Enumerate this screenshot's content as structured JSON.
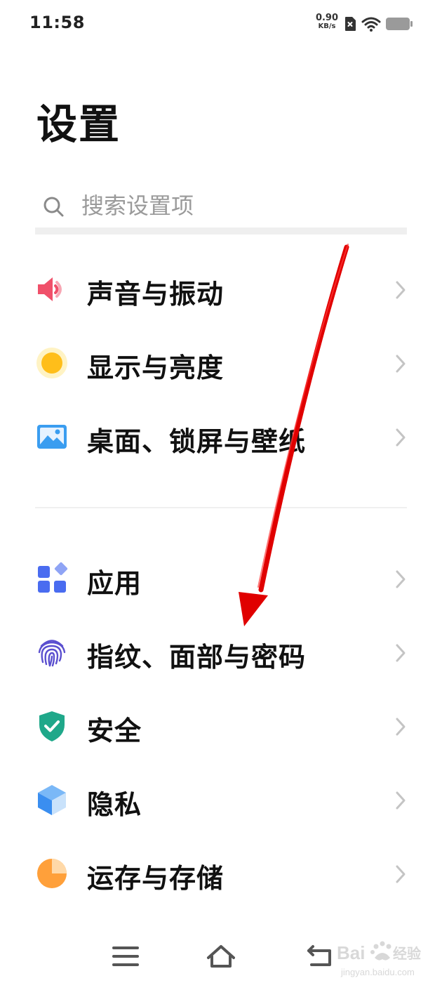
{
  "status_bar": {
    "time": "11:58",
    "net_speed_value": "0.90",
    "net_speed_unit": "KB/s",
    "icons": [
      "sim-error-icon",
      "wifi-icon",
      "battery-icon"
    ]
  },
  "page": {
    "title": "设置"
  },
  "search": {
    "placeholder": "搜索设置项",
    "value": ""
  },
  "menu": {
    "items": [
      {
        "label": "声音与振动",
        "icon": "speaker-icon",
        "color": "#f0506a"
      },
      {
        "label": "显示与亮度",
        "icon": "sun-icon",
        "color": "#ffbe1a"
      },
      {
        "label": "桌面、锁屏与壁纸",
        "icon": "picture-icon",
        "color": "#3a9df0"
      },
      {
        "label": "应用",
        "icon": "apps-grid-icon",
        "color": "#4a6cf0"
      },
      {
        "label": "指纹、面部与密码",
        "icon": "fingerprint-icon",
        "color": "#5a4fcf"
      },
      {
        "label": "安全",
        "icon": "shield-check-icon",
        "color": "#1fa88a"
      },
      {
        "label": "隐私",
        "icon": "cube-icon",
        "color": "#3a8ef0"
      },
      {
        "label": "运存与存储",
        "icon": "pie-chart-icon",
        "color": "#ffa03a"
      }
    ]
  },
  "nav_bar": {
    "buttons": [
      "menu-icon",
      "home-icon",
      "back-icon"
    ]
  },
  "annotation": {
    "arrow_color": "#e00000"
  },
  "watermark": {
    "brand": "Bai",
    "brand_suffix": "经验",
    "url": "jingyan.baidu.com"
  }
}
